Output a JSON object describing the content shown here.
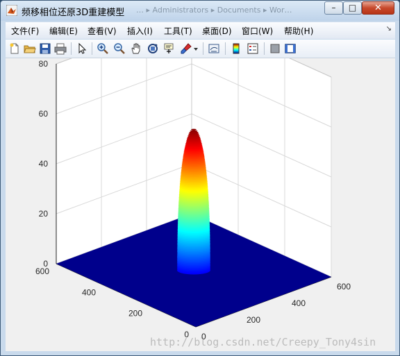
{
  "window": {
    "title": "频移相位还原3D重建模型",
    "background_titles": "… ▸ Administrators ▸ Documents ▸ Wor…",
    "minimize_label": "–",
    "maximize_label": "□",
    "close_label": "✕"
  },
  "menu": {
    "items": [
      {
        "label": "文件(F)"
      },
      {
        "label": "编辑(E)"
      },
      {
        "label": "查看(V)"
      },
      {
        "label": "插入(I)"
      },
      {
        "label": "工具(T)"
      },
      {
        "label": "桌面(D)"
      },
      {
        "label": "窗口(W)"
      },
      {
        "label": "帮助(H)"
      }
    ],
    "overflow_arrow": "↘"
  },
  "toolbar": {
    "icons": [
      "new-figure-icon",
      "open-file-icon",
      "save-icon",
      "print-icon",
      "pointer-icon",
      "zoom-in-icon",
      "zoom-out-icon",
      "pan-hand-icon",
      "rotate-3d-icon",
      "data-cursor-icon",
      "brush-icon",
      "brush-dropdown-icon",
      "link-plot-icon",
      "colorbar-icon",
      "legend-icon",
      "hide-plot-tools-icon",
      "show-plot-tools-icon"
    ]
  },
  "colors": {
    "plane": "#00008c",
    "axes_grid": "#d8d8d8",
    "axes_box": "#ffffff",
    "colormap": "jet"
  },
  "chart_data": {
    "type": "surface",
    "title": "",
    "xlabel": "",
    "ylabel": "",
    "zlabel": "",
    "xlim": [
      0,
      600
    ],
    "ylim": [
      0,
      600
    ],
    "zlim": [
      0,
      80
    ],
    "x_ticks": [
      "0",
      "200",
      "400",
      "600"
    ],
    "y_ticks": [
      "0",
      "200",
      "400",
      "600"
    ],
    "z_ticks": [
      "0",
      "20",
      "40",
      "60",
      "80"
    ],
    "grid": true,
    "colormap": "jet",
    "peak": {
      "x_center": 300,
      "y_center": 300,
      "height": 57,
      "base_width": 140
    },
    "base_value": 0
  },
  "watermark": "http://blog.csdn.net/Creepy_Tony4sin"
}
